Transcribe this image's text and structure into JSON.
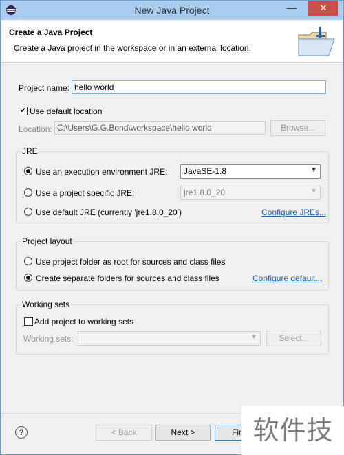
{
  "window": {
    "title": "New Java Project",
    "minimize_glyph": "—",
    "close_glyph": "✕"
  },
  "header": {
    "title": "Create a Java Project",
    "description": "Create a Java project in the workspace or in an external location."
  },
  "project": {
    "name_label": "Project name:",
    "name_value": "hello world",
    "use_default_location_label": "Use default location",
    "use_default_location_checked": true,
    "location_label": "Location:",
    "location_value": "C:\\Users\\G.G.Bond\\workspace\\hello world",
    "browse_label": "Browse..."
  },
  "jre": {
    "title": "JRE",
    "opt_execution_env": "Use an execution environment JRE:",
    "execution_env_value": "JavaSE-1.8",
    "opt_project_specific": "Use a project specific JRE:",
    "project_specific_value": "jre1.8.0_20",
    "opt_default": "Use default JRE (currently 'jre1.8.0_20')",
    "configure_link": "Configure JREs...",
    "selected": "execution_env"
  },
  "layout": {
    "title": "Project layout",
    "opt_root": "Use project folder as root for sources and class files",
    "opt_separate": "Create separate folders for sources and class files",
    "configure_link": "Configure default...",
    "selected": "separate"
  },
  "working_sets": {
    "title": "Working sets",
    "add_label": "Add project to working sets",
    "add_checked": false,
    "sets_label": "Working sets:",
    "sets_value": "",
    "select_label": "Select..."
  },
  "footer": {
    "help_glyph": "?",
    "back_label": "< Back",
    "next_label": "Next >",
    "finish_label": "Fin"
  },
  "watermark": {
    "text": "软件技巧"
  },
  "colors": {
    "titlebar": "#a9cdef",
    "close": "#c9504a",
    "link": "#1a5fb4",
    "focus_border": "#7ab5d6"
  }
}
